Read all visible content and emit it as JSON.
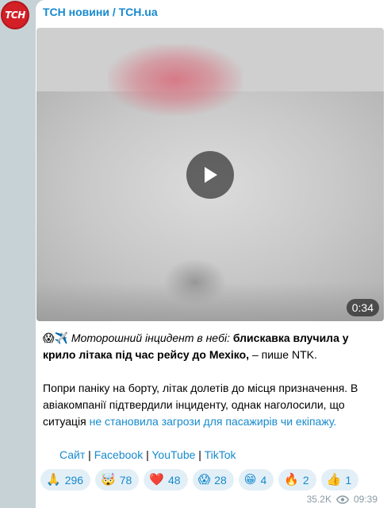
{
  "channel": {
    "avatar_text": "ТСН",
    "name": "ТСН новини / TCH.ua"
  },
  "video": {
    "duration": "0:34"
  },
  "post": {
    "emoji_prefix": "😱✈️",
    "italic_text": "Моторошний інцидент в небі:",
    "bold_text": "блискавка влучила у крило літака під час рейсу до Мехіко,",
    "tail_text": " – пише NTK.",
    "para2_text": "Попри паніку на борту, літак долетів до місця призначення. В авіакомпанії підтвердили інциденту, однак наголосили, що ситуація ",
    "para2_link": "не становила загрози для пасажирів чи екіпажу."
  },
  "links": {
    "site": "Сайт",
    "facebook": "Facebook",
    "youtube": "YouTube",
    "tiktok": "TikTok",
    "separator": " | "
  },
  "reactions": [
    {
      "emoji": "🙏",
      "count": "296",
      "icon": "pray-icon"
    },
    {
      "emoji": "🤯",
      "count": "78",
      "icon": "exploding-head-icon"
    },
    {
      "emoji": "❤️",
      "count": "48",
      "icon": "heart-icon"
    },
    {
      "emoji": "😱",
      "count": "28",
      "icon": "scream-icon"
    },
    {
      "emoji": "😁",
      "count": "4",
      "icon": "grin-icon"
    },
    {
      "emoji": "🔥",
      "count": "2",
      "icon": "fire-icon"
    },
    {
      "emoji": "👍",
      "count": "1",
      "icon": "thumbs-up-icon"
    }
  ],
  "meta": {
    "views": "35.2K",
    "time": "09:39"
  },
  "colors": {
    "accent": "#168acd",
    "brand": "#d32027",
    "background": "#c7d2d6"
  }
}
